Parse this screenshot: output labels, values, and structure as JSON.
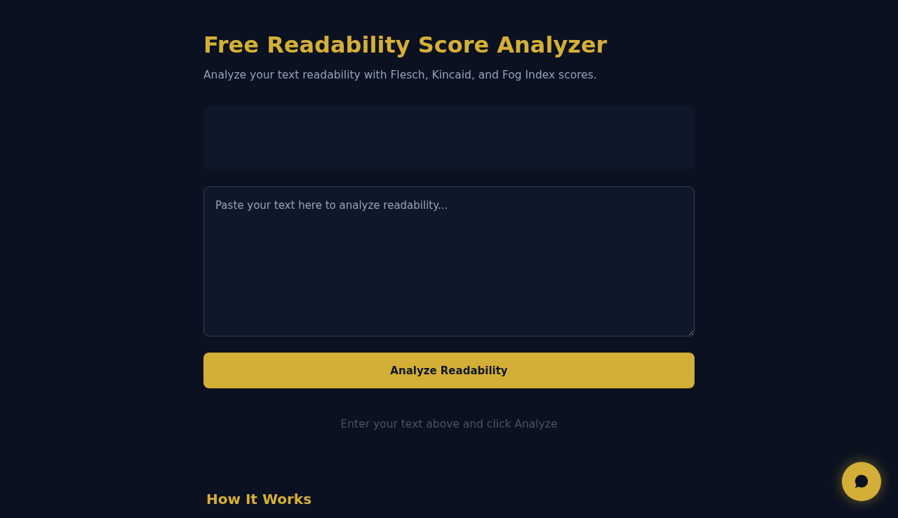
{
  "header": {
    "title": "Free Readability Score Analyzer",
    "subtitle": "Analyze your text readability with Flesch, Kincaid, and Fog Index scores."
  },
  "text_input": {
    "placeholder": "Paste your text here to analyze readability..."
  },
  "analyze_button": {
    "label": "Analyze Readability"
  },
  "status_message": "Enter your text above and click Analyze",
  "how_it_works": {
    "heading": "How It Works"
  }
}
